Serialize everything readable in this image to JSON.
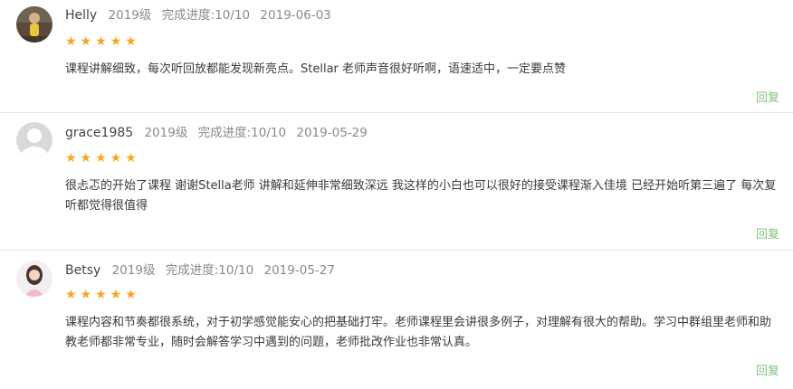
{
  "reviews": [
    {
      "user": "Helly",
      "grade": "2019级",
      "progress": "完成进度:10/10",
      "date": "2019-06-03",
      "rating": 5,
      "stars": "★★★★★",
      "avatar_icon": "user-photo-avatar",
      "content": "课程讲解细致，每次听回放都能发现新亮点。Stellar 老师声音很好听啊，语速适中，一定要点赞",
      "reply_label": "回复"
    },
    {
      "user": "grace1985",
      "grade": "2019级",
      "progress": "完成进度:10/10",
      "date": "2019-05-29",
      "rating": 5,
      "stars": "★★★★★",
      "avatar_icon": "default-gray-avatar",
      "content": "很忐忑的开始了课程 谢谢Stella老师 讲解和延伸非常细致深远 我这样的小白也可以很好的接受课程渐入佳境 已经开始听第三遍了 每次复听都觉得很值得",
      "reply_label": "回复"
    },
    {
      "user": "Betsy",
      "grade": "2019级",
      "progress": "完成进度:10/10",
      "date": "2019-05-27",
      "rating": 5,
      "stars": "★★★★★",
      "avatar_icon": "user-photo-avatar",
      "content": "课程内容和节奏都很系统，对于初学感觉能安心的把基础打牢。老师课程里会讲很多例子，对理解有很大的帮助。学习中群组里老师和助教老师都非常专业，随时会解答学习中遇到的问题，老师批改作业也非常认真。",
      "reply_label": "回复"
    }
  ],
  "colors": {
    "star": "#f5a623",
    "reply": "#7cc37a",
    "divider": "#e6e6e6"
  }
}
